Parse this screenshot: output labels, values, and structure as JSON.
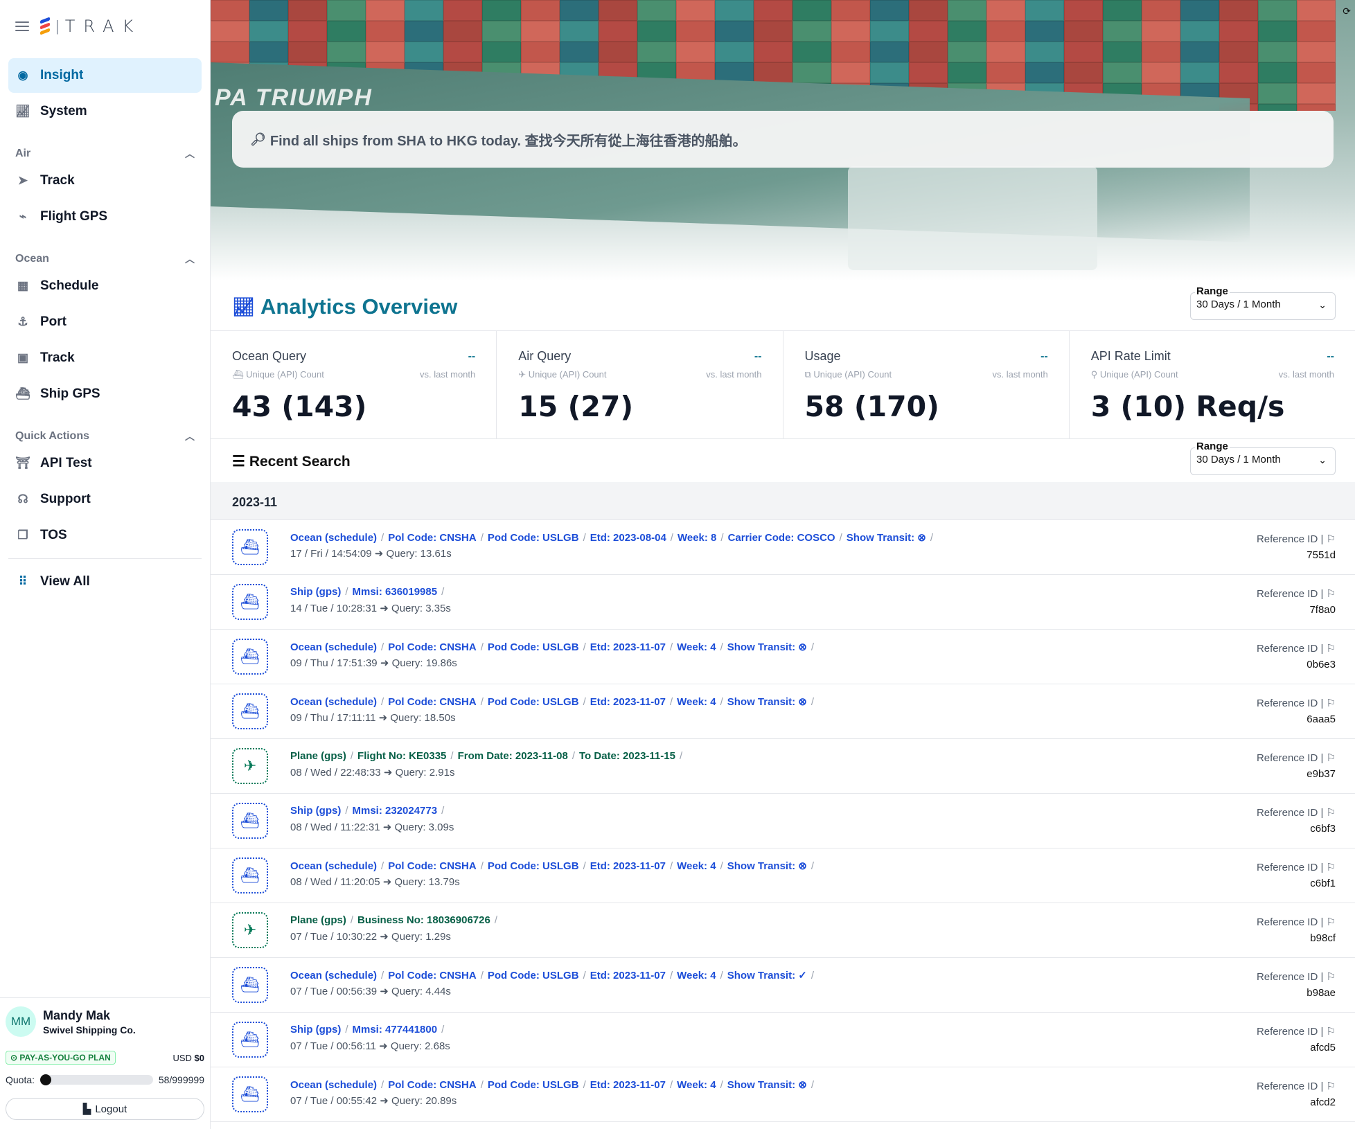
{
  "brand": {
    "name": "TRAK"
  },
  "nav": {
    "top": [
      {
        "label": "Insight",
        "icon": "insight-icon",
        "active": true
      },
      {
        "label": "System",
        "icon": "chart-line-icon"
      }
    ],
    "air": {
      "title": "Air",
      "items": [
        {
          "label": "Track",
          "icon": "paper-plane-icon"
        },
        {
          "label": "Flight GPS",
          "icon": "route-icon"
        }
      ]
    },
    "ocean": {
      "title": "Ocean",
      "items": [
        {
          "label": "Schedule",
          "icon": "calendar-icon"
        },
        {
          "label": "Port",
          "icon": "anchor-icon"
        },
        {
          "label": "Track",
          "icon": "train-icon"
        },
        {
          "label": "Ship GPS",
          "icon": "ship-gps-icon"
        }
      ]
    },
    "quick": {
      "title": "Quick Actions",
      "items": [
        {
          "label": "API Test",
          "icon": "api-icon"
        },
        {
          "label": "Support",
          "icon": "headset-icon"
        },
        {
          "label": "TOS",
          "icon": "copy-icon"
        }
      ]
    },
    "view_all": "View All"
  },
  "user": {
    "initials": "MM",
    "name": "Mandy Mak",
    "company": "Swivel Shipping Co.",
    "plan": "PAY-AS-YOU-GO PLAN",
    "usd_label": "USD",
    "usd_value": "$0",
    "quota_label": "Quota:",
    "quota_value": "58/999999",
    "quota_fraction": 6e-05,
    "logout": "Logout"
  },
  "hero": {
    "search_placeholder": "Find all ships from SHA to HKG today. 查找今天所有從上海往香港的船舶。",
    "ship_name": "PA TRIUMPH"
  },
  "analytics": {
    "title": "Analytics Overview",
    "range_label": "Range",
    "range_value": "30 Days / 1 Month",
    "stats": [
      {
        "title": "Ocean Query",
        "trend": "--",
        "sub": "Unique (API) Count",
        "vs": "vs. last month",
        "value": "43 (143)"
      },
      {
        "title": "Air Query",
        "trend": "--",
        "sub": "Unique (API) Count",
        "vs": "vs. last month",
        "value": "15 (27)"
      },
      {
        "title": "Usage",
        "trend": "--",
        "sub": "Unique (API) Count",
        "vs": "vs. last month",
        "value": "58 (170)"
      },
      {
        "title": "API Rate Limit",
        "trend": "--",
        "sub": "Unique (API) Count",
        "vs": "vs. last month",
        "value": "3 (10) Req/s"
      }
    ]
  },
  "recent": {
    "title": "Recent Search",
    "range_label": "Range",
    "range_value": "30 Days / 1 Month",
    "month": "2023-11",
    "ref_label": "Reference ID",
    "rows": [
      {
        "kind": "ship",
        "parts": [
          "Ocean (schedule)",
          "Pol Code: CNSHA",
          "Pod Code: USLGB",
          "Etd: 2023-08-04",
          "Week: 8",
          "Carrier Code: COSCO",
          "Show Transit: ⊗"
        ],
        "time": "17 / Fri / 14:54:09",
        "query": "Query: 13.61s",
        "ref": "7551d"
      },
      {
        "kind": "ship",
        "parts": [
          "Ship (gps)",
          "Mmsi: 636019985"
        ],
        "time": "14 / Tue / 10:28:31",
        "query": "Query: 3.35s",
        "ref": "7f8a0"
      },
      {
        "kind": "ship",
        "parts": [
          "Ocean (schedule)",
          "Pol Code: CNSHA",
          "Pod Code: USLGB",
          "Etd: 2023-11-07",
          "Week: 4",
          "Show Transit: ⊗"
        ],
        "time": "09 / Thu / 17:51:39",
        "query": "Query: 19.86s",
        "ref": "0b6e3"
      },
      {
        "kind": "ship",
        "parts": [
          "Ocean (schedule)",
          "Pol Code: CNSHA",
          "Pod Code: USLGB",
          "Etd: 2023-11-07",
          "Week: 4",
          "Show Transit: ⊗"
        ],
        "time": "09 / Thu / 17:11:11",
        "query": "Query: 18.50s",
        "ref": "6aaa5"
      },
      {
        "kind": "plane",
        "parts": [
          "Plane (gps)",
          "Flight No: KE0335",
          "From Date: 2023-11-08",
          "To Date: 2023-11-15"
        ],
        "time": "08 / Wed / 22:48:33",
        "query": "Query: 2.91s",
        "ref": "e9b37"
      },
      {
        "kind": "ship",
        "parts": [
          "Ship (gps)",
          "Mmsi: 232024773"
        ],
        "time": "08 / Wed / 11:22:31",
        "query": "Query: 3.09s",
        "ref": "c6bf3"
      },
      {
        "kind": "ship",
        "parts": [
          "Ocean (schedule)",
          "Pol Code: CNSHA",
          "Pod Code: USLGB",
          "Etd: 2023-11-07",
          "Week: 4",
          "Show Transit: ⊗"
        ],
        "time": "08 / Wed / 11:20:05",
        "query": "Query: 13.79s",
        "ref": "c6bf1"
      },
      {
        "kind": "plane",
        "parts": [
          "Plane (gps)",
          "Business No: 18036906726"
        ],
        "time": "07 / Tue / 10:30:22",
        "query": "Query: 1.29s",
        "ref": "b98cf"
      },
      {
        "kind": "ship",
        "parts": [
          "Ocean (schedule)",
          "Pol Code: CNSHA",
          "Pod Code: USLGB",
          "Etd: 2023-11-07",
          "Week: 4",
          "Show Transit: ✓"
        ],
        "time": "07 / Tue / 00:56:39",
        "query": "Query: 4.44s",
        "ref": "b98ae"
      },
      {
        "kind": "ship",
        "parts": [
          "Ship (gps)",
          "Mmsi: 477441800"
        ],
        "time": "07 / Tue / 00:56:11",
        "query": "Query: 2.68s",
        "ref": "afcd5"
      },
      {
        "kind": "ship",
        "parts": [
          "Ocean (schedule)",
          "Pol Code: CNSHA",
          "Pod Code: USLGB",
          "Etd: 2023-11-07",
          "Week: 4",
          "Show Transit: ⊗"
        ],
        "time": "07 / Tue / 00:55:42",
        "query": "Query: 20.89s",
        "ref": "afcd2"
      }
    ]
  },
  "colors": {
    "accent": "#0e7490",
    "ship": "#1d4ed8",
    "plane": "#047857",
    "active_bg": "#e0f2fe"
  }
}
